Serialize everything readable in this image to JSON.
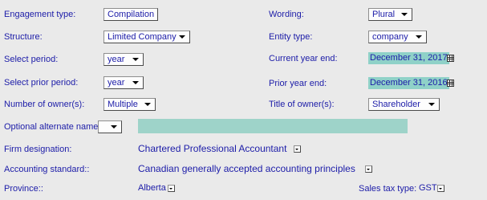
{
  "left": {
    "engagement_type_label": "Engagement type:",
    "engagement_type_value": "Compilation",
    "structure_label": "Structure:",
    "structure_value": "Limited Company",
    "select_period_label": "Select period:",
    "select_period_value": "year",
    "select_prior_period_label": "Select prior period:",
    "select_prior_period_value": "year",
    "owners_label": "Number of owner(s):",
    "owners_value": "Multiple",
    "alt_name_label": "Optional alternate name:",
    "alt_name_value": ""
  },
  "right": {
    "wording_label": "Wording:",
    "wording_value": "Plural",
    "entity_type_label": "Entity type:",
    "entity_type_value": "company",
    "current_year_end_label": "Current year end:",
    "current_year_end_value": "December 31, 2017",
    "prior_year_end_label": "Prior year end:",
    "prior_year_end_value": "December 31, 2016",
    "title_owner_label": "Title of owner(s):",
    "title_owner_value": "Shareholder"
  },
  "bottom": {
    "firm_designation_label": "Firm designation:",
    "firm_designation_value": "Chartered Professional Accountant",
    "accounting_standard_label": "Accounting standard::",
    "accounting_standard_value": "Canadian generally accepted accounting principles",
    "province_label": "Province::",
    "province_value": "Alberta",
    "sales_tax_label": "Sales tax type:",
    "sales_tax_value": "GST"
  },
  "colors": {
    "label": "#1c1ca8",
    "background": "#eaeaea",
    "field_highlight": "#8fd1c8"
  }
}
